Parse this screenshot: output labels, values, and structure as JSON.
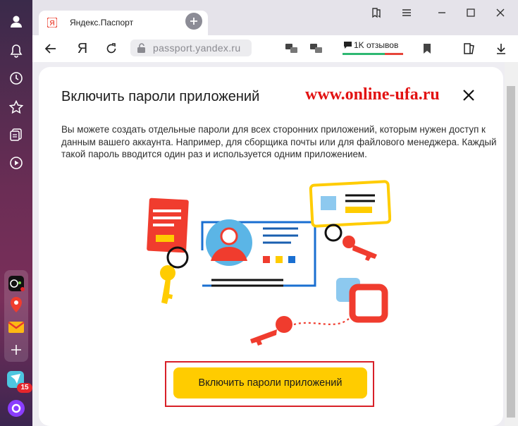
{
  "window": {
    "minimize_label": "",
    "maximize_label": "",
    "close_label": ""
  },
  "tab": {
    "title": "Яндекс.Паспорт",
    "favicon_letter": "Я"
  },
  "toolbar": {
    "yandex_letter": "Я",
    "url": "passport.yandex.ru",
    "reviews_label": "1K отзывов",
    "reviews_colors": {
      "positive": "#2eb872",
      "negative": "#e6453a"
    }
  },
  "sidebar": {
    "items": [
      "profile-icon",
      "notifications-icon",
      "history-icon",
      "favorites-icon",
      "collections-icon",
      "media-icon"
    ],
    "apps": [
      "alice-radio",
      "maps",
      "mail",
      "add"
    ],
    "messenger_badge": "15"
  },
  "dialog": {
    "title": "Включить пароли приложений",
    "watermark": "www.online-ufa.ru",
    "description": "Вы можете создать отдельные пароли для всех сторонних приложений, которым нужен доступ к данным вашего аккаунта. Например, для сборщика почты или для файлового менеджера. Каждый такой пароль вводится один раз и используется одним приложением.",
    "cta_label": "Включить пароли приложений"
  },
  "colors": {
    "accent": "#ffcc00",
    "highlight": "#d82028",
    "watermark": "#e21212"
  }
}
